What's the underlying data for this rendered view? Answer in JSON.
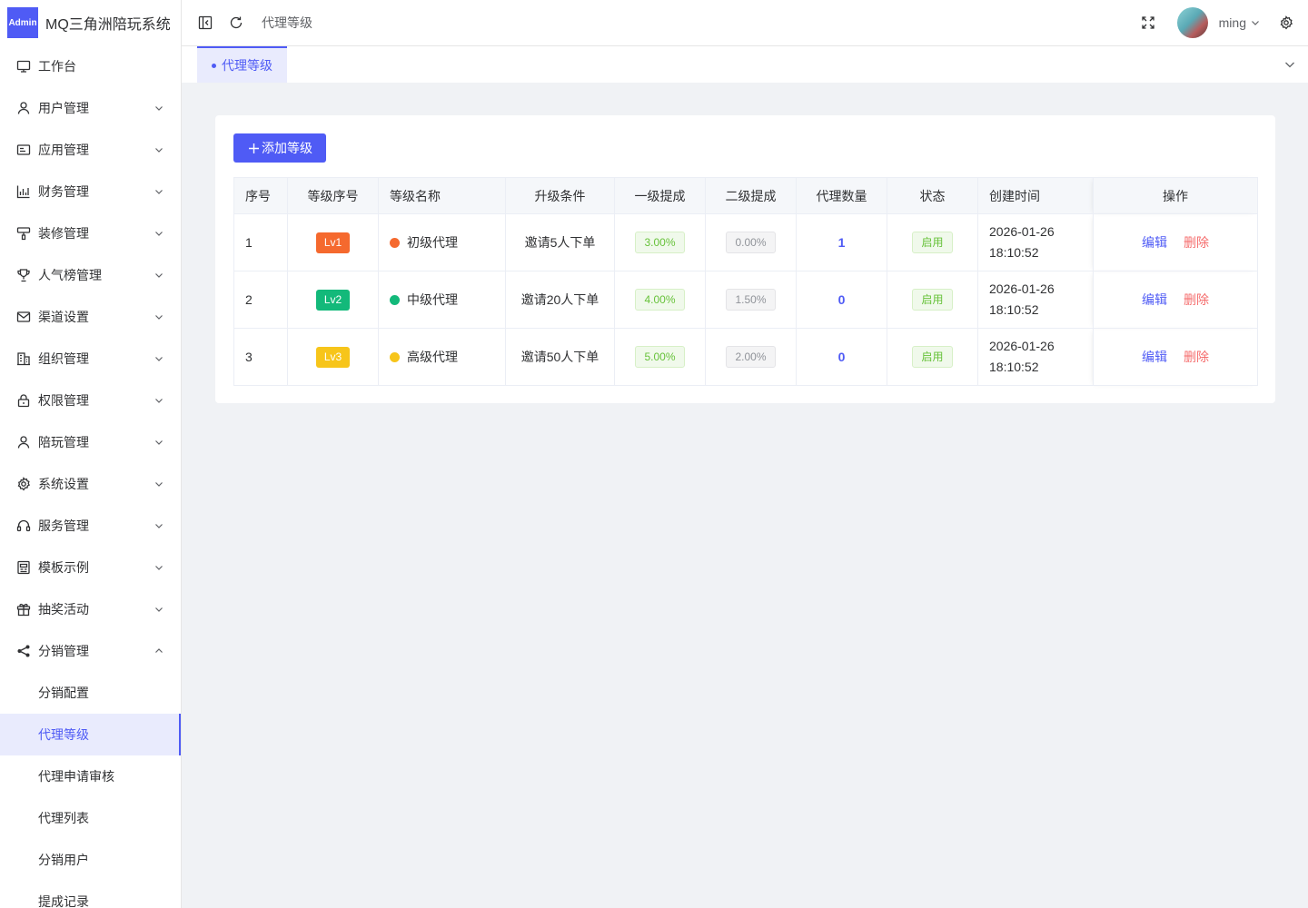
{
  "app": {
    "badge": "Admin",
    "title": "MQ三角洲陪玩系统"
  },
  "header": {
    "breadcrumb": "代理等级",
    "username": "ming"
  },
  "tabs": [
    {
      "label": "代理等级"
    }
  ],
  "sidebar": {
    "items": [
      {
        "label": "工作台",
        "icon": "monitor-icon"
      },
      {
        "label": "用户管理",
        "icon": "user-icon"
      },
      {
        "label": "应用管理",
        "icon": "app-card-icon"
      },
      {
        "label": "财务管理",
        "icon": "bar-chart-icon"
      },
      {
        "label": "装修管理",
        "icon": "paint-icon"
      },
      {
        "label": "人气榜管理",
        "icon": "trophy-icon"
      },
      {
        "label": "渠道设置",
        "icon": "mail-icon"
      },
      {
        "label": "组织管理",
        "icon": "building-icon"
      },
      {
        "label": "权限管理",
        "icon": "lock-icon"
      },
      {
        "label": "陪玩管理",
        "icon": "user-icon"
      },
      {
        "label": "系统设置",
        "icon": "gear-icon"
      },
      {
        "label": "服务管理",
        "icon": "headset-icon"
      },
      {
        "label": "模板示例",
        "icon": "template-icon"
      },
      {
        "label": "抽奖活动",
        "icon": "gift-icon"
      },
      {
        "label": "分销管理",
        "icon": "share-icon"
      }
    ],
    "subitems": [
      "分销配置",
      "代理等级",
      "代理申请审核",
      "代理列表",
      "分销用户",
      "提成记录"
    ]
  },
  "toolbar": {
    "add_label": "添加等级"
  },
  "table": {
    "headers": [
      "序号",
      "等级序号",
      "等级名称",
      "升级条件",
      "一级提成",
      "二级提成",
      "代理数量",
      "状态",
      "创建时间",
      "操作"
    ],
    "rows": [
      {
        "index": "1",
        "level": "Lv1",
        "level_color": "#f5692e",
        "name": "初级代理",
        "dot_color": "#f5692e",
        "condition": "邀请5人下单",
        "rate1": "3.00%",
        "rate2": "0.00%",
        "count": "1",
        "status": "启用",
        "date": "2026-01-26",
        "time": "18:10:52",
        "edit": "编辑",
        "delete": "删除"
      },
      {
        "index": "2",
        "level": "Lv2",
        "level_color": "#13b97a",
        "name": "中级代理",
        "dot_color": "#13b97a",
        "condition": "邀请20人下单",
        "rate1": "4.00%",
        "rate2": "1.50%",
        "count": "0",
        "status": "启用",
        "date": "2026-01-26",
        "time": "18:10:52",
        "edit": "编辑",
        "delete": "删除"
      },
      {
        "index": "3",
        "level": "Lv3",
        "level_color": "#f7c51a",
        "name": "高级代理",
        "dot_color": "#f7c51a",
        "condition": "邀请50人下单",
        "rate1": "5.00%",
        "rate2": "2.00%",
        "count": "0",
        "status": "启用",
        "date": "2026-01-26",
        "time": "18:10:52",
        "edit": "编辑",
        "delete": "删除"
      }
    ]
  },
  "colors": {
    "primary": "#4f5bf5",
    "success": "#67c23a",
    "danger": "#f56c6c"
  }
}
